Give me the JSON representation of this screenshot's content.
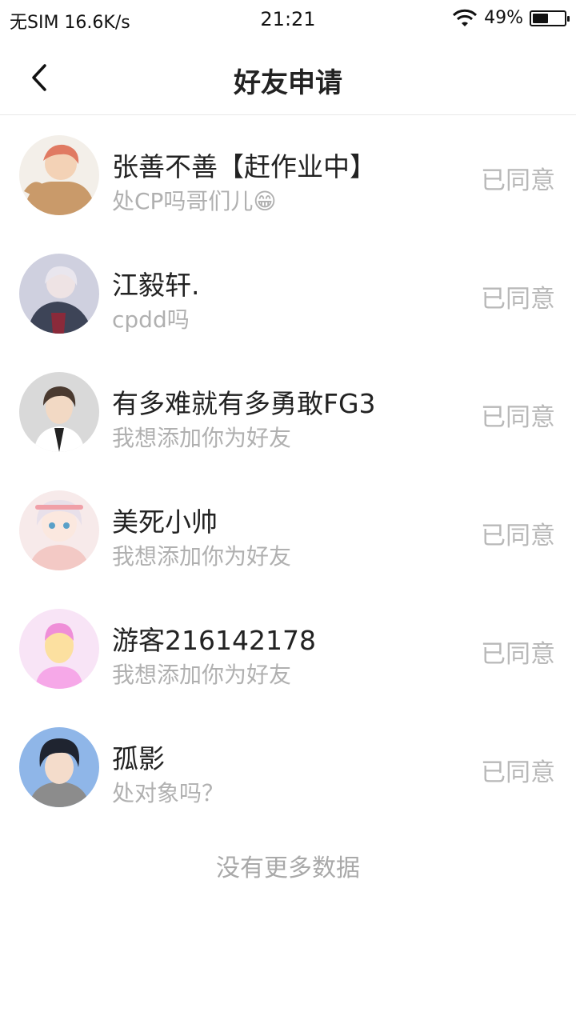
{
  "status_bar": {
    "carrier": "无SIM 16.6K/s",
    "time": "21:21",
    "battery": "49%",
    "battery_level": 0.49,
    "icons": [
      "wifi-icon",
      "battery-icon"
    ]
  },
  "header": {
    "title": "好友申请",
    "back_icon": "chevron-left-icon"
  },
  "requests": [
    {
      "name": "张善不善【赶作业中】",
      "message": "处CP吗哥们儿😁",
      "status": "已同意"
    },
    {
      "name": "江毅轩.",
      "message": "cpdd吗",
      "status": "已同意"
    },
    {
      "name": "有多难就有多勇敢FG3",
      "message": "我想添加你为好友",
      "status": "已同意"
    },
    {
      "name": "美死小帅",
      "message": "我想添加你为好友",
      "status": "已同意"
    },
    {
      "name": "游客216142178",
      "message": "我想添加你为好友",
      "status": "已同意"
    },
    {
      "name": "孤影",
      "message": "处对象吗？",
      "status": "已同意"
    }
  ],
  "footer": {
    "no_more": "没有更多数据"
  }
}
